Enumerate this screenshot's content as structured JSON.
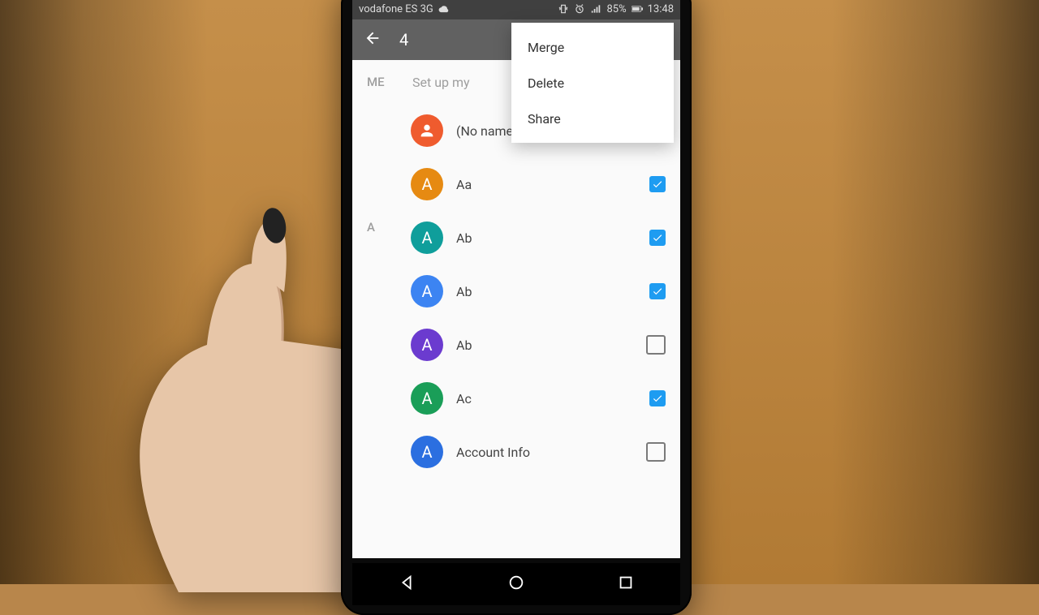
{
  "status_bar": {
    "carrier": "vodafone ES 3G",
    "battery": "85%",
    "clock": "13:48"
  },
  "action_bar": {
    "selected_count": "4"
  },
  "overflow_menu": {
    "items": [
      "Merge",
      "Delete",
      "Share"
    ]
  },
  "me_section": {
    "header": "ME",
    "label": "Set up my"
  },
  "section_letter": "A",
  "contacts": [
    {
      "name": "(No name)",
      "initial": "",
      "color": "#ef5b2e",
      "checked": false,
      "person_icon": true
    },
    {
      "name": "Aa",
      "initial": "A",
      "color": "#e68a12",
      "checked": true
    },
    {
      "name": "Ab",
      "initial": "A",
      "color": "#0f9e9b",
      "checked": true
    },
    {
      "name": "Ab",
      "initial": "A",
      "color": "#3c84f2",
      "checked": true
    },
    {
      "name": "Ab",
      "initial": "A",
      "color": "#6b3bcf",
      "checked": false
    },
    {
      "name": "Ac",
      "initial": "A",
      "color": "#1a9e58",
      "checked": true
    },
    {
      "name": "Account Info",
      "initial": "A",
      "color": "#2b6fe0",
      "checked": false
    }
  ]
}
